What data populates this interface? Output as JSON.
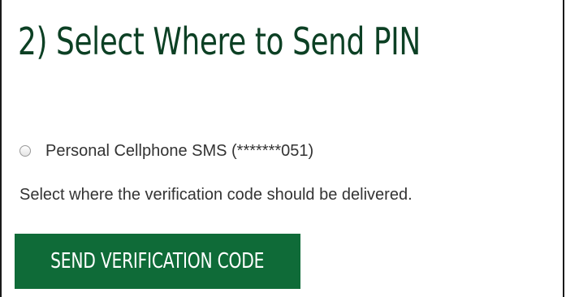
{
  "step": {
    "heading": "2) Select Where to Send PIN"
  },
  "options": [
    {
      "label": "Personal Cellphone SMS (*******051)",
      "selected": false
    }
  ],
  "help_text": "Select where the verification code should be delivered.",
  "actions": {
    "send_label": "SEND VERIFICATION CODE"
  },
  "colors": {
    "heading": "#0c4024",
    "button_bg": "#0f6b38",
    "button_text": "#ffffff",
    "body_text": "#333333"
  }
}
